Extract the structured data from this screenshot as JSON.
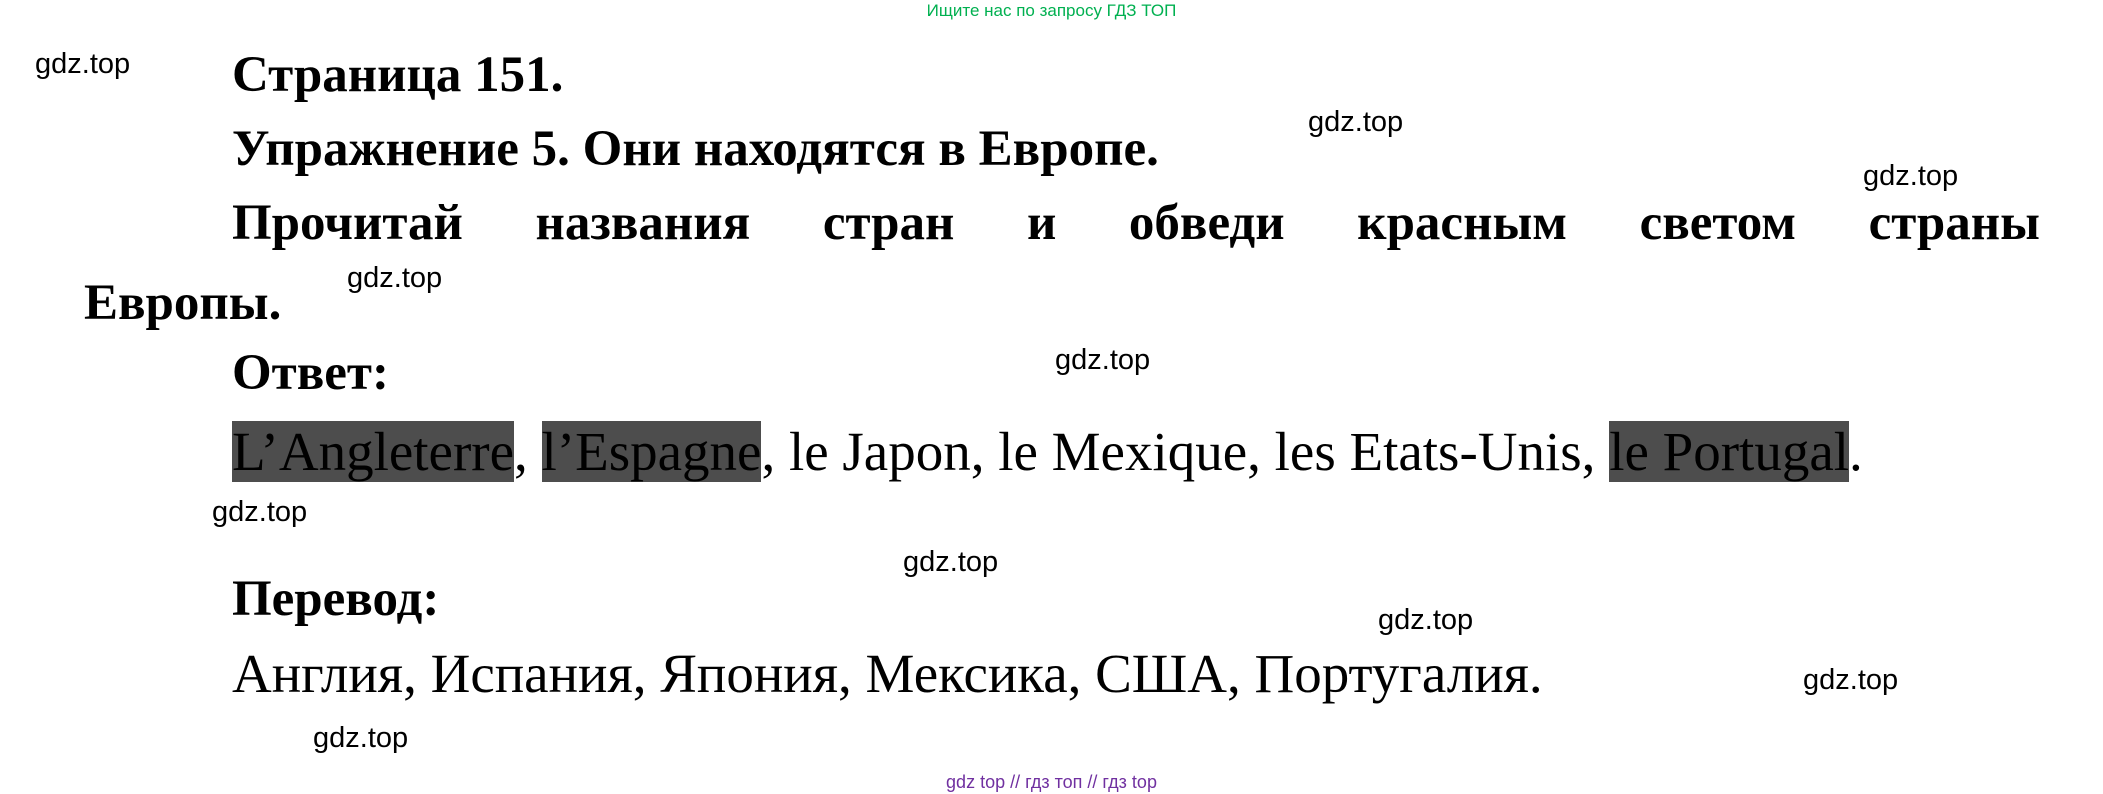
{
  "banner": "Ищите нас по запросу ГДЗ ТОП",
  "page_title": "Страница 151.",
  "exercise_title": "Упражнение 5. Они находятся в Европе.",
  "task_part1": "Прочитай названия стран и обведи красным светом страны",
  "task_part2": "Европы.",
  "answer_label": "Ответ:",
  "answer": {
    "item1": "L’Angleterre",
    "sep1": ", ",
    "item2": "l’Espagne",
    "middle": ", le Japon, le Mexique, les Etats-Unis, ",
    "item3": "le Portugal",
    "end": "."
  },
  "translation_label": "Перевод:",
  "translation": "Англия, Испания, Япония, Мексика, США, Португалия.",
  "watermark": "gdz.top",
  "footer": "gdz top  //  гдз топ  //  гдз top",
  "colors": {
    "banner": "#00b050",
    "footer": "#7030a0",
    "highlight": "#4d4d4d"
  }
}
